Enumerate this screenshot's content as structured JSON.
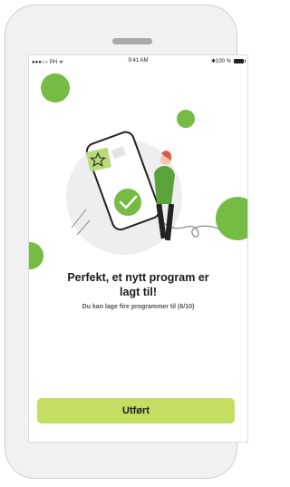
{
  "status_bar": {
    "carrier": "●●●○○ PH ᯤ",
    "time": "9:41 AM",
    "battery_text": "✱100 %"
  },
  "message": {
    "title_line1": "Perfekt, et nytt program er",
    "title_line2": "lagt til!",
    "subtitle": "Du kan lage fire programmer til (6/10)"
  },
  "actions": {
    "done_label": "Utført"
  },
  "colors": {
    "accent_green": "#76bb43",
    "button_green": "#c4de64"
  },
  "icons": {
    "success": "checkmark-icon",
    "favorite": "star-icon"
  }
}
